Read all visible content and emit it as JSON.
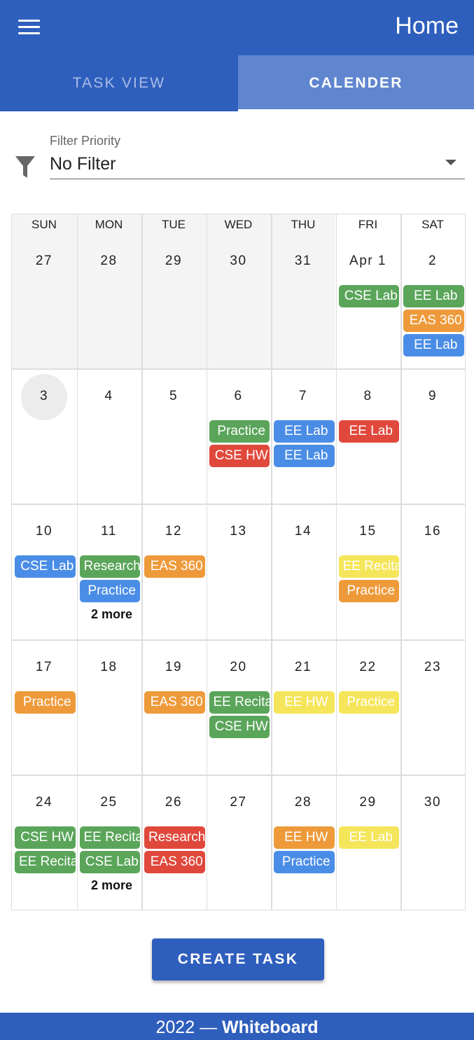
{
  "app": {
    "title": "Home"
  },
  "tabs": [
    {
      "label": "TASK VIEW",
      "active": false
    },
    {
      "label": "CALENDER",
      "active": true
    }
  ],
  "filter": {
    "label": "Filter Priority",
    "value": "No Filter"
  },
  "calendar": {
    "days_of_week": [
      "SUN",
      "MON",
      "TUE",
      "WED",
      "THU",
      "FRI",
      "SAT"
    ],
    "colors": {
      "green": "#5aa55a",
      "orange": "#ee9a3a",
      "blue": "#4a8de6",
      "red": "#e0483c",
      "yellow": "#f5e55a"
    },
    "weeks": [
      [
        {
          "label": "27",
          "out_of_month": true,
          "events": []
        },
        {
          "label": "28",
          "out_of_month": true,
          "events": []
        },
        {
          "label": "29",
          "out_of_month": true,
          "events": []
        },
        {
          "label": "30",
          "out_of_month": true,
          "events": []
        },
        {
          "label": "31",
          "out_of_month": true,
          "events": []
        },
        {
          "label": "Apr 1",
          "events": [
            {
              "title": "CSE Lab",
              "color": "green"
            }
          ]
        },
        {
          "label": "2",
          "events": [
            {
              "title": "EE Lab",
              "color": "green"
            },
            {
              "title": "EAS 360",
              "color": "orange"
            },
            {
              "title": "EE Lab",
              "color": "blue"
            }
          ]
        }
      ],
      [
        {
          "label": "3",
          "today": true,
          "events": []
        },
        {
          "label": "4",
          "events": []
        },
        {
          "label": "5",
          "events": []
        },
        {
          "label": "6",
          "events": [
            {
              "title": "Practice",
              "color": "green"
            },
            {
              "title": "CSE HW",
              "color": "red"
            }
          ]
        },
        {
          "label": "7",
          "events": [
            {
              "title": "EE Lab",
              "color": "blue"
            },
            {
              "title": "EE Lab",
              "color": "blue"
            }
          ]
        },
        {
          "label": "8",
          "events": [
            {
              "title": "EE Lab",
              "color": "red"
            }
          ]
        },
        {
          "label": "9",
          "events": []
        }
      ],
      [
        {
          "label": "10",
          "events": [
            {
              "title": "CSE Lab",
              "color": "blue"
            }
          ]
        },
        {
          "label": "11",
          "events": [
            {
              "title": "Research",
              "color": "green"
            },
            {
              "title": "Practice",
              "color": "blue"
            }
          ],
          "more": "2 more"
        },
        {
          "label": "12",
          "events": [
            {
              "title": "EAS 360",
              "color": "orange"
            }
          ]
        },
        {
          "label": "13",
          "events": []
        },
        {
          "label": "14",
          "events": []
        },
        {
          "label": "15",
          "events": [
            {
              "title": "EE Recitation",
              "color": "yellow"
            },
            {
              "title": "Practice",
              "color": "orange"
            }
          ]
        },
        {
          "label": "16",
          "events": []
        }
      ],
      [
        {
          "label": "17",
          "events": [
            {
              "title": "Practice",
              "color": "orange"
            }
          ]
        },
        {
          "label": "18",
          "events": []
        },
        {
          "label": "19",
          "events": [
            {
              "title": "EAS 360",
              "color": "orange"
            }
          ]
        },
        {
          "label": "20",
          "events": [
            {
              "title": "EE Recitation",
              "color": "green"
            },
            {
              "title": "CSE HW",
              "color": "green"
            }
          ]
        },
        {
          "label": "21",
          "events": [
            {
              "title": "EE HW",
              "color": "yellow"
            }
          ]
        },
        {
          "label": "22",
          "events": [
            {
              "title": "Practice",
              "color": "yellow"
            }
          ]
        },
        {
          "label": "23",
          "events": []
        }
      ],
      [
        {
          "label": "24",
          "events": [
            {
              "title": "CSE HW",
              "color": "green"
            },
            {
              "title": "EE Recitation",
              "color": "green"
            }
          ]
        },
        {
          "label": "25",
          "events": [
            {
              "title": "EE Recitation",
              "color": "green"
            },
            {
              "title": "CSE Lab",
              "color": "green"
            }
          ],
          "more": "2 more"
        },
        {
          "label": "26",
          "events": [
            {
              "title": "Research",
              "color": "red"
            },
            {
              "title": "EAS 360",
              "color": "red"
            }
          ]
        },
        {
          "label": "27",
          "events": []
        },
        {
          "label": "28",
          "events": [
            {
              "title": "EE HW",
              "color": "orange"
            },
            {
              "title": "Practice",
              "color": "blue"
            }
          ]
        },
        {
          "label": "29",
          "events": [
            {
              "title": "EE Lab",
              "color": "yellow"
            }
          ]
        },
        {
          "label": "30",
          "events": []
        }
      ]
    ]
  },
  "actions": {
    "create_label": "CREATE TASK"
  },
  "footer": {
    "year": "2022",
    "separator": "—",
    "brand": "Whiteboard"
  }
}
